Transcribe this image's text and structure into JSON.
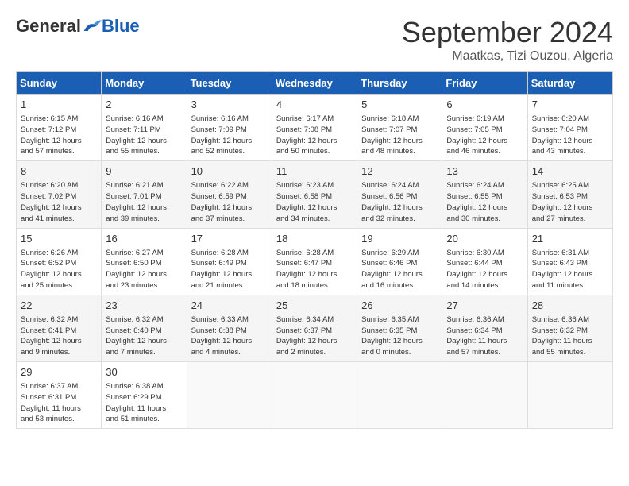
{
  "logo": {
    "general": "General",
    "blue": "Blue"
  },
  "header": {
    "month": "September 2024",
    "location": "Maatkas, Tizi Ouzou, Algeria"
  },
  "weekdays": [
    "Sunday",
    "Monday",
    "Tuesday",
    "Wednesday",
    "Thursday",
    "Friday",
    "Saturday"
  ],
  "weeks": [
    [
      {
        "day": "1",
        "info": "Sunrise: 6:15 AM\nSunset: 7:12 PM\nDaylight: 12 hours\nand 57 minutes."
      },
      {
        "day": "2",
        "info": "Sunrise: 6:16 AM\nSunset: 7:11 PM\nDaylight: 12 hours\nand 55 minutes."
      },
      {
        "day": "3",
        "info": "Sunrise: 6:16 AM\nSunset: 7:09 PM\nDaylight: 12 hours\nand 52 minutes."
      },
      {
        "day": "4",
        "info": "Sunrise: 6:17 AM\nSunset: 7:08 PM\nDaylight: 12 hours\nand 50 minutes."
      },
      {
        "day": "5",
        "info": "Sunrise: 6:18 AM\nSunset: 7:07 PM\nDaylight: 12 hours\nand 48 minutes."
      },
      {
        "day": "6",
        "info": "Sunrise: 6:19 AM\nSunset: 7:05 PM\nDaylight: 12 hours\nand 46 minutes."
      },
      {
        "day": "7",
        "info": "Sunrise: 6:20 AM\nSunset: 7:04 PM\nDaylight: 12 hours\nand 43 minutes."
      }
    ],
    [
      {
        "day": "8",
        "info": "Sunrise: 6:20 AM\nSunset: 7:02 PM\nDaylight: 12 hours\nand 41 minutes."
      },
      {
        "day": "9",
        "info": "Sunrise: 6:21 AM\nSunset: 7:01 PM\nDaylight: 12 hours\nand 39 minutes."
      },
      {
        "day": "10",
        "info": "Sunrise: 6:22 AM\nSunset: 6:59 PM\nDaylight: 12 hours\nand 37 minutes."
      },
      {
        "day": "11",
        "info": "Sunrise: 6:23 AM\nSunset: 6:58 PM\nDaylight: 12 hours\nand 34 minutes."
      },
      {
        "day": "12",
        "info": "Sunrise: 6:24 AM\nSunset: 6:56 PM\nDaylight: 12 hours\nand 32 minutes."
      },
      {
        "day": "13",
        "info": "Sunrise: 6:24 AM\nSunset: 6:55 PM\nDaylight: 12 hours\nand 30 minutes."
      },
      {
        "day": "14",
        "info": "Sunrise: 6:25 AM\nSunset: 6:53 PM\nDaylight: 12 hours\nand 27 minutes."
      }
    ],
    [
      {
        "day": "15",
        "info": "Sunrise: 6:26 AM\nSunset: 6:52 PM\nDaylight: 12 hours\nand 25 minutes."
      },
      {
        "day": "16",
        "info": "Sunrise: 6:27 AM\nSunset: 6:50 PM\nDaylight: 12 hours\nand 23 minutes."
      },
      {
        "day": "17",
        "info": "Sunrise: 6:28 AM\nSunset: 6:49 PM\nDaylight: 12 hours\nand 21 minutes."
      },
      {
        "day": "18",
        "info": "Sunrise: 6:28 AM\nSunset: 6:47 PM\nDaylight: 12 hours\nand 18 minutes."
      },
      {
        "day": "19",
        "info": "Sunrise: 6:29 AM\nSunset: 6:46 PM\nDaylight: 12 hours\nand 16 minutes."
      },
      {
        "day": "20",
        "info": "Sunrise: 6:30 AM\nSunset: 6:44 PM\nDaylight: 12 hours\nand 14 minutes."
      },
      {
        "day": "21",
        "info": "Sunrise: 6:31 AM\nSunset: 6:43 PM\nDaylight: 12 hours\nand 11 minutes."
      }
    ],
    [
      {
        "day": "22",
        "info": "Sunrise: 6:32 AM\nSunset: 6:41 PM\nDaylight: 12 hours\nand 9 minutes."
      },
      {
        "day": "23",
        "info": "Sunrise: 6:32 AM\nSunset: 6:40 PM\nDaylight: 12 hours\nand 7 minutes."
      },
      {
        "day": "24",
        "info": "Sunrise: 6:33 AM\nSunset: 6:38 PM\nDaylight: 12 hours\nand 4 minutes."
      },
      {
        "day": "25",
        "info": "Sunrise: 6:34 AM\nSunset: 6:37 PM\nDaylight: 12 hours\nand 2 minutes."
      },
      {
        "day": "26",
        "info": "Sunrise: 6:35 AM\nSunset: 6:35 PM\nDaylight: 12 hours\nand 0 minutes."
      },
      {
        "day": "27",
        "info": "Sunrise: 6:36 AM\nSunset: 6:34 PM\nDaylight: 11 hours\nand 57 minutes."
      },
      {
        "day": "28",
        "info": "Sunrise: 6:36 AM\nSunset: 6:32 PM\nDaylight: 11 hours\nand 55 minutes."
      }
    ],
    [
      {
        "day": "29",
        "info": "Sunrise: 6:37 AM\nSunset: 6:31 PM\nDaylight: 11 hours\nand 53 minutes."
      },
      {
        "day": "30",
        "info": "Sunrise: 6:38 AM\nSunset: 6:29 PM\nDaylight: 11 hours\nand 51 minutes."
      },
      {
        "day": "",
        "info": ""
      },
      {
        "day": "",
        "info": ""
      },
      {
        "day": "",
        "info": ""
      },
      {
        "day": "",
        "info": ""
      },
      {
        "day": "",
        "info": ""
      }
    ]
  ]
}
